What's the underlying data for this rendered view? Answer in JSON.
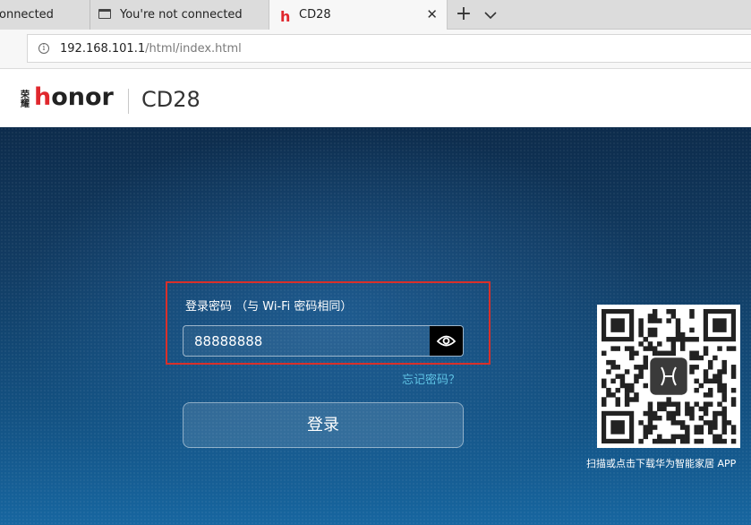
{
  "browser": {
    "tabs": [
      {
        "label": "onnected",
        "active": false
      },
      {
        "label": "You're not connected",
        "active": false
      },
      {
        "label": "CD28",
        "active": true
      }
    ],
    "new_tab_symbol": "+",
    "close_symbol": "✕",
    "url": {
      "host": "192.168.101.1",
      "path": "/html/index.html"
    },
    "icons": [
      "page-icon",
      "honor-favicon",
      "close-icon",
      "plus-icon",
      "chevron-down-icon",
      "info-icon"
    ]
  },
  "header": {
    "logo_cn": "荣耀",
    "logo_text_red": "h",
    "logo_text_rest": "onor",
    "model": "CD28"
  },
  "login": {
    "password_label": "登录密码 （与 Wi-Fi 密码相同）",
    "password_value": "88888888",
    "forgot_link": "忘记密码？",
    "login_button": "登录",
    "eye_icon": "eye-icon"
  },
  "app_promo": {
    "caption": "扫描或点击下载华为智能家居 APP"
  },
  "colors": {
    "brand_red": "#e0272d",
    "highlight_red": "#d9302a",
    "link_cyan": "#5fc3e4",
    "background_navy": "#123c63"
  }
}
